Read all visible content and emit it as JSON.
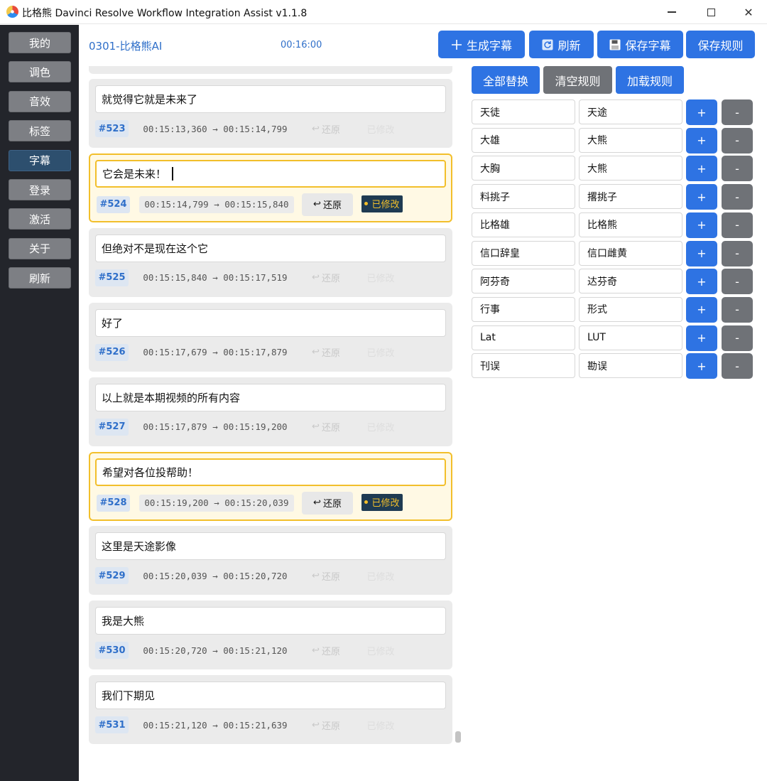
{
  "window": {
    "title": "比格熊 Davinci Resolve Workflow Integration Assist v1.1.8",
    "minimize_glyph": "",
    "maximize_glyph": "",
    "close_glyph": "✕"
  },
  "sidebar": {
    "items": [
      {
        "label": "我的",
        "active": false
      },
      {
        "label": "调色",
        "active": false
      },
      {
        "label": "音效",
        "active": false
      },
      {
        "label": "标签",
        "active": false
      },
      {
        "label": "字幕",
        "active": true
      },
      {
        "label": "登录",
        "active": false
      },
      {
        "label": "激活",
        "active": false
      },
      {
        "label": "关于",
        "active": false
      },
      {
        "label": "刷新",
        "active": false
      }
    ]
  },
  "header": {
    "project_name": "0301-比格熊AI",
    "timecode": "00:16:00"
  },
  "toolbar": {
    "generate_label": "生成字幕",
    "generate_icon": "plus-icon",
    "refresh_label": "刷新",
    "refresh_icon": "refresh-icon",
    "save_subs_label": "保存字幕",
    "save_subs_icon": "floppy-icon",
    "save_rules_label": "保存规则"
  },
  "rule_actions": {
    "replace_all": "全部替换",
    "clear_rules": "清空规则",
    "load_rules": "加载规则"
  },
  "rules": [
    {
      "from": "天徒",
      "to": "天途",
      "add": "+",
      "remove": "-"
    },
    {
      "from": "大雄",
      "to": "大熊",
      "add": "+",
      "remove": "-"
    },
    {
      "from": "大胸",
      "to": "大熊",
      "add": "+",
      "remove": "-"
    },
    {
      "from": "料挑子",
      "to": "撂挑子",
      "add": "+",
      "remove": "-"
    },
    {
      "from": "比格雄",
      "to": "比格熊",
      "add": "+",
      "remove": "-"
    },
    {
      "from": "信口辞皇",
      "to": "信口雌黄",
      "add": "+",
      "remove": "-"
    },
    {
      "from": "阿芬奇",
      "to": "达芬奇",
      "add": "+",
      "remove": "-"
    },
    {
      "from": "行事",
      "to": "形式",
      "add": "+",
      "remove": "-"
    },
    {
      "from": "Lat",
      "to": "LUT",
      "add": "+",
      "remove": "-"
    },
    {
      "from": "刊误",
      "to": "勘误",
      "add": "+",
      "remove": "-"
    }
  ],
  "subtitles": [
    {
      "text": "就觉得它就是未来了",
      "id": "#523",
      "range": "00:15:13,360 → 00:15:14,799",
      "restore": "还原",
      "restore_icon": "undo-icon",
      "status": "已修改",
      "modified": false
    },
    {
      "text": "它会是未来！",
      "id": "#524",
      "range": "00:15:14,799 → 00:15:15,840",
      "restore": "还原",
      "restore_icon": "undo-icon",
      "status": "已修改",
      "modified": true
    },
    {
      "text": "但绝对不是现在这个它",
      "id": "#525",
      "range": "00:15:15,840 → 00:15:17,519",
      "restore": "还原",
      "restore_icon": "undo-icon",
      "status": "已修改",
      "modified": false
    },
    {
      "text": "好了",
      "id": "#526",
      "range": "00:15:17,679 → 00:15:17,879",
      "restore": "还原",
      "restore_icon": "undo-icon",
      "status": "已修改",
      "modified": false
    },
    {
      "text": "以上就是本期视频的所有内容",
      "id": "#527",
      "range": "00:15:17,879 → 00:15:19,200",
      "restore": "还原",
      "restore_icon": "undo-icon",
      "status": "已修改",
      "modified": false
    },
    {
      "text": "希望对各位投帮助！",
      "id": "#528",
      "range": "00:15:19,200 → 00:15:20,039",
      "restore": "还原",
      "restore_icon": "undo-icon",
      "status": "已修改",
      "modified": true
    },
    {
      "text": "这里是天途影像",
      "id": "#529",
      "range": "00:15:20,039 → 00:15:20,720",
      "restore": "还原",
      "restore_icon": "undo-icon",
      "status": "已修改",
      "modified": false
    },
    {
      "text": "我是大熊",
      "id": "#530",
      "range": "00:15:20,720 → 00:15:21,120",
      "restore": "还原",
      "restore_icon": "undo-icon",
      "status": "已修改",
      "modified": false
    },
    {
      "text": "我们下期见",
      "id": "#531",
      "range": "00:15:21,120 → 00:15:21,639",
      "restore": "还原",
      "restore_icon": "undo-icon",
      "status": "已修改",
      "modified": false
    }
  ],
  "colors": {
    "accent_blue": "#2e73e3",
    "modified_border": "#f2bf2b",
    "sidebar_bg": "#23252b",
    "grey_button": "#6f7277"
  }
}
